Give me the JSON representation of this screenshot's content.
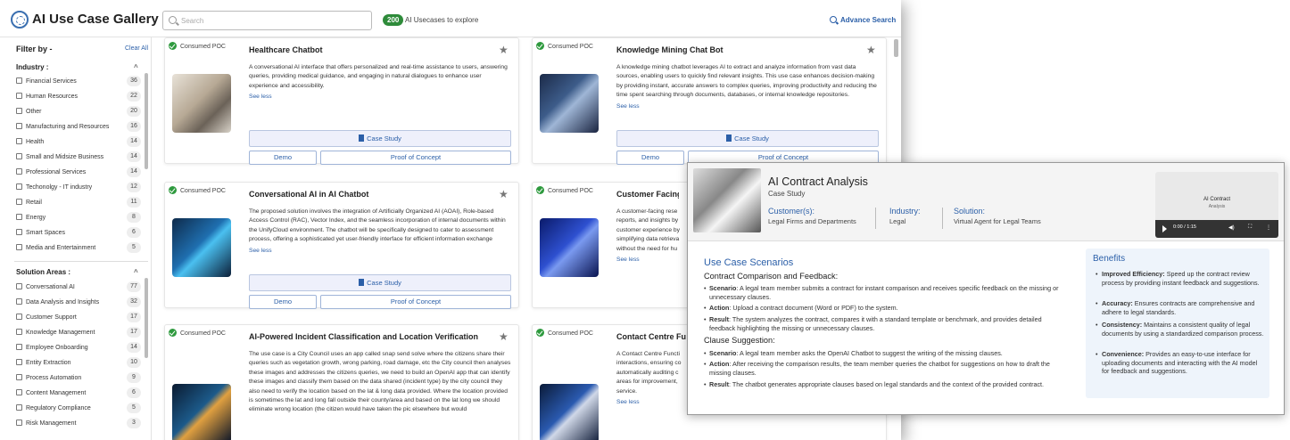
{
  "app": {
    "title": "AI Use Case Gallery"
  },
  "search": {
    "placeholder": "Search"
  },
  "count": {
    "value": "200",
    "label": "AI Usecases to explore"
  },
  "advance_search": "Advance Search",
  "sidebar": {
    "filter_by": "Filter by -",
    "clear_all": "Clear All",
    "industry": {
      "title": "Industry :",
      "items": [
        {
          "label": "Financial Services",
          "count": "36"
        },
        {
          "label": "Human Resources",
          "count": "22"
        },
        {
          "label": "Other",
          "count": "20"
        },
        {
          "label": "Manufacturing and Resources",
          "count": "16"
        },
        {
          "label": "Health",
          "count": "14"
        },
        {
          "label": "Small and Midsize Business",
          "count": "14"
        },
        {
          "label": "Professional Services",
          "count": "14"
        },
        {
          "label": "Techonolgy - IT industry",
          "count": "12"
        },
        {
          "label": "Retail",
          "count": "11"
        },
        {
          "label": "Energy",
          "count": "8"
        },
        {
          "label": "Smart Spaces",
          "count": "6"
        },
        {
          "label": "Media and Entertainment",
          "count": "5"
        }
      ]
    },
    "solution": {
      "title": "Solution Areas :",
      "items": [
        {
          "label": "Conversational AI",
          "count": "77"
        },
        {
          "label": "Data Analysis and Insights",
          "count": "32"
        },
        {
          "label": "Customer Support",
          "count": "17"
        },
        {
          "label": "Knowledge Management",
          "count": "17"
        },
        {
          "label": "Employee Onboarding",
          "count": "14"
        },
        {
          "label": "Entity Extraction",
          "count": "10"
        },
        {
          "label": "Process Automation",
          "count": "9"
        },
        {
          "label": "Content Management",
          "count": "6"
        },
        {
          "label": "Regulatory Compliance",
          "count": "5"
        },
        {
          "label": "Risk Management",
          "count": "3"
        }
      ]
    }
  },
  "cards": [
    {
      "tag": "Consumed POC",
      "title": "Healthcare Chatbot",
      "desc": "A conversational AI interface that offers personalized and real-time assistance to users, answering queries, providing medical guidance, and engaging in natural dialogues to enhance user experience and accessibility.",
      "see_less": "See less",
      "case_study": "Case Study",
      "demo": "Demo",
      "poc": "Proof of Concept"
    },
    {
      "tag": "Consumed POC",
      "title": "Knowledge Mining Chat Bot",
      "desc": "A knowledge mining chatbot leverages AI to extract and analyze information from vast data sources, enabling users to quickly find relevant insights. This use case enhances decision-making by providing instant, accurate answers to complex queries, improving productivity and reducing the time spent searching through documents, databases, or internal knowledge repositories.",
      "see_less": "See less",
      "case_study": "Case Study",
      "demo": "Demo",
      "poc": "Proof of Concept"
    },
    {
      "tag": "Consumed POC",
      "title": "Conversational AI in AI Chatbot",
      "desc": "The proposed solution involves the integration of Artificially Organized AI (AOAI), Role-based Access Control (RAC), Vector Index, and the seamless incorporation of internal documents within the UnifyCloud environment. The chatbot will be specifically designed to cater to assessment process, offering a sophisticated yet user-friendly interface for efficient information exchange",
      "see_less": "See less",
      "case_study": "Case Study",
      "demo": "Demo",
      "poc": "Proof of Concept"
    },
    {
      "tag": "Consumed POC",
      "title": "Customer Facing R",
      "desc": "A customer-facing rese reports, and insights by customer experience by simplifying data retrieva without the need for hu",
      "see_less": "See less"
    },
    {
      "tag": "Consumed POC",
      "title": "AI-Powered Incident Classification and Location Verification",
      "desc": "The use case is a City Council uses an app called snap send solve where the citizens share their queries such as vegetation growth, wrong parking, road damage, etc the City council then analyses these images and addresses the citizens queries, we need to build an OpenAI app that can identify these images and classify them based on the data shared (incident type) by the city council they also need to verify the location based on the lat & long data provided. Where the location provided is sometimes the lat and long fall outside their county/area and based on the lat long we should eliminate wrong location (the citizen would have taken the pic elsewhere but would"
    },
    {
      "tag": "Consumed POC",
      "title": "Contact Centre Fu",
      "desc": "A Contact Centre Functi interactions, ensuring co automatically auditing c areas for improvement, service.",
      "see_less": "See less"
    }
  ],
  "detail": {
    "title": "AI Contract Analysis",
    "subtitle": "Case Study",
    "customers_label": "Customer(s):",
    "customers_value": "Legal Firms and Departments",
    "industry_label": "Industry:",
    "industry_value": "Legal",
    "solution_label": "Solution:",
    "solution_value": "Virtual Agent for Legal Teams",
    "video": {
      "title": "AI Contract",
      "subtitle": "Analysis",
      "time": "0:00 / 1:15"
    },
    "scenarios_title": "Use Case Scenarios",
    "s1_title": "Contract Comparison and Feedback:",
    "s1": [
      {
        "k": "Scenario",
        "v": ": A legal team member submits a contract for instant comparison and receives specific feedback on the missing or unnecessary clauses."
      },
      {
        "k": "Action",
        "v": ": Upload a contract document (Word or PDF) to the system."
      },
      {
        "k": "Result",
        "v": ": The system analyzes the contract, compares it with a standard template or benchmark, and provides detailed feedback highlighting the missing or unnecessary clauses."
      }
    ],
    "s2_title": "Clause Suggestion:",
    "s2": [
      {
        "k": "Scenario",
        "v": ": A legal team member asks the OpenAI Chatbot to suggest the writing of the missing clauses."
      },
      {
        "k": "Action",
        "v": ": After receiving the comparison results, the team member queries the chatbot for suggestions on how to draft the missing clauses."
      },
      {
        "k": "Result",
        "v": ": The chatbot generates appropriate clauses based on legal standards and the context of the provided contract."
      }
    ],
    "benefits_title": "Benefits",
    "benefits": [
      {
        "k": "Improved Efficiency:",
        "v": " Speed up the contract review process by providing instant feedback and suggestions."
      },
      {
        "k": "Accuracy:",
        "v": " Ensures contracts are comprehensive and adhere to legal standards."
      },
      {
        "k": "Consistency:",
        "v": " Maintains a consistent quality of legal documents by using a standardized comparison process."
      },
      {
        "k": "Convenience:",
        "v": " Provides an easy-to-use interface for uploading documents and interacting with the AI model for feedback and suggestions."
      }
    ]
  }
}
